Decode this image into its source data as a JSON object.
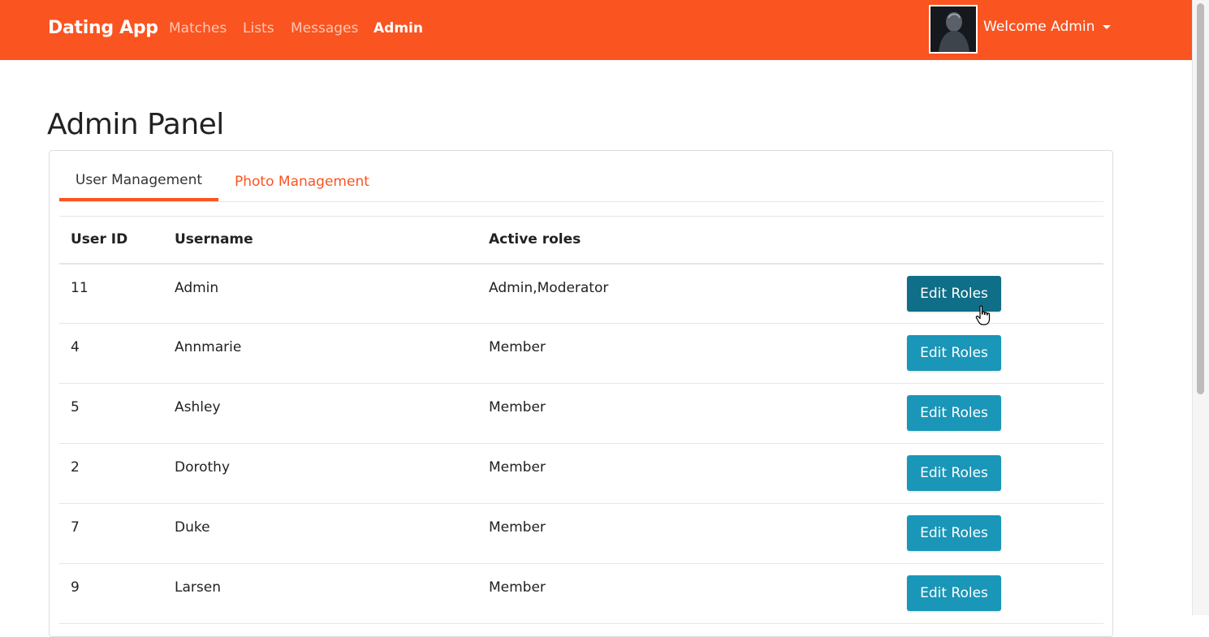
{
  "navbar": {
    "brand": "Dating App",
    "links": [
      "Matches",
      "Lists",
      "Messages",
      "Admin"
    ],
    "active_link": "Admin",
    "welcome": "Welcome Admin",
    "accent": "#fa5421"
  },
  "page": {
    "title": "Admin Panel"
  },
  "tabs": [
    {
      "label": "User Management",
      "active": true
    },
    {
      "label": "Photo Management",
      "active": false
    }
  ],
  "table": {
    "headers": [
      "User ID",
      "Username",
      "Active roles"
    ],
    "rows": [
      {
        "id": "11",
        "username": "Admin",
        "roles": "Admin,Moderator",
        "button": "Edit Roles"
      },
      {
        "id": "4",
        "username": "Annmarie",
        "roles": "Member",
        "button": "Edit Roles"
      },
      {
        "id": "5",
        "username": "Ashley",
        "roles": "Member",
        "button": "Edit Roles"
      },
      {
        "id": "2",
        "username": "Dorothy",
        "roles": "Member",
        "button": "Edit Roles"
      },
      {
        "id": "7",
        "username": "Duke",
        "roles": "Member",
        "button": "Edit Roles"
      },
      {
        "id": "9",
        "username": "Larsen",
        "roles": "Member",
        "button": "Edit Roles"
      }
    ],
    "button_color": "#1a96b8"
  },
  "icons": {
    "cursor": "hand-pointer-icon",
    "dropdown": "caret-down-icon"
  }
}
